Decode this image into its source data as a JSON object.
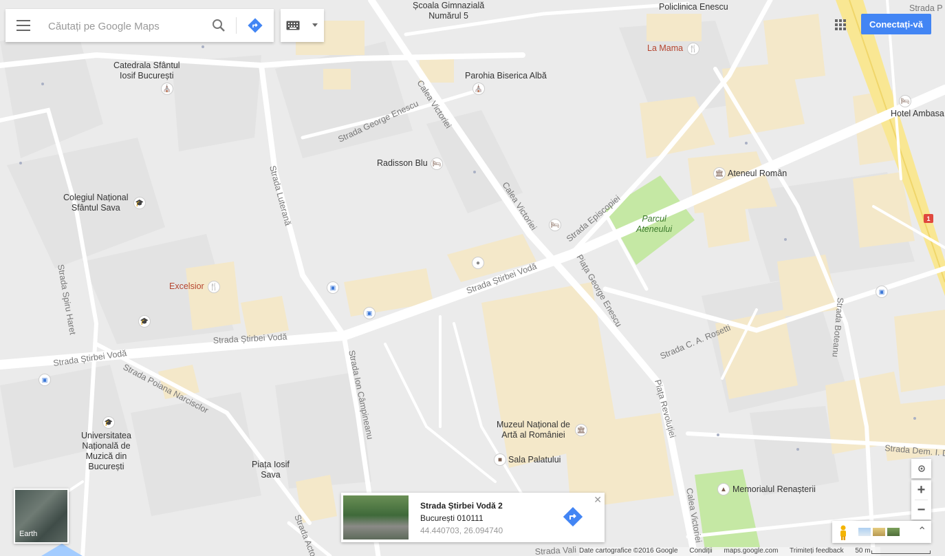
{
  "search": {
    "placeholder": "Căutați pe Google Maps"
  },
  "header": {
    "signin_label": "Conectați-vă"
  },
  "map": {
    "streets": [
      "Strada Știrbei Vodă",
      "Strada Știrbei Vodă",
      "Strada Știrbei Vodă",
      "Calea Victoriei",
      "Calea Victoriei",
      "Calea Victoriei",
      "Strada George Enescu",
      "Strada Luterană",
      "Strada Episcopiei",
      "Piața George Enescu",
      "Strada C. A. Rosetti",
      "Strada Boteanu",
      "Piața Revoluției",
      "Strada Ion Câmpineanu",
      "Strada Poiana Narcisclor",
      "Strada Spiru Haret",
      "Strada Dem. I. D",
      "Strada Actor",
      "Strada Vali",
      "Strada P"
    ],
    "pois": [
      "Școala Gimnazială\nNumărul 5",
      "Policlinica Enescu",
      "La Mama",
      "Catedrala Sfântul\nIosif București",
      "Parohia Biserica Albă",
      "Hotel Ambasa",
      "Radisson Blu",
      "Ateneul Român",
      "Colegiul Național\nSfântul Sava",
      "Parcul\nAteneului",
      "Excelsior",
      "Universitatea\nNațională de\nMuzică din\nBucurești",
      "Piața Iosif\nSava",
      "Muzeul Național de\nArtă al României",
      "Sala Palatului",
      "Memorialul Renașterii"
    ],
    "route_badge": "1"
  },
  "earth": {
    "label": "Earth"
  },
  "card": {
    "title": "Strada Știrbei Vodă 2",
    "address": "București 010111",
    "coords": "44.440703, 26.094740"
  },
  "controls": {
    "zoom_in": "+",
    "zoom_out": "−",
    "expand": "⌃"
  },
  "footer": {
    "map_data": "Date cartografice ©2016 Google",
    "terms": "Condiții",
    "site": "maps.google.com",
    "feedback": "Trimiteți feedback",
    "scale": "50 m"
  },
  "colors": {
    "accent": "#4285f4",
    "park": "#c5e8a4",
    "building": "#f4e8c9",
    "highway": "#f9e793"
  }
}
